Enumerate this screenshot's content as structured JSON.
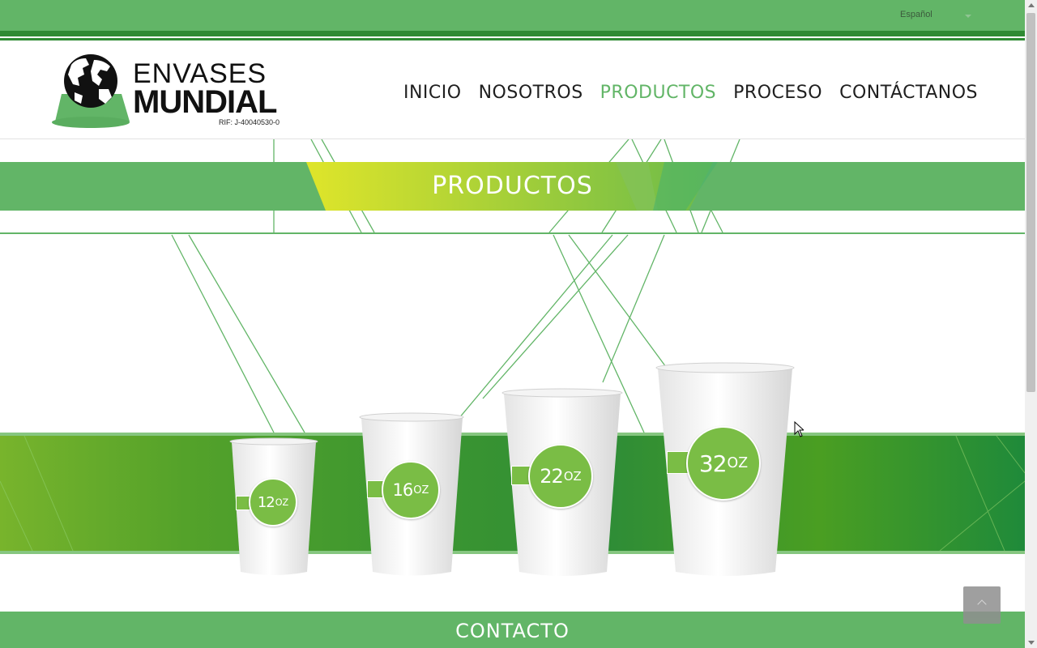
{
  "language_selector": {
    "value": "Español"
  },
  "logo": {
    "word1": "ENVASES",
    "word2": "MUNDIAL",
    "rif": "RIF: J-40040530-0"
  },
  "nav": {
    "items": [
      {
        "label": "INICIO",
        "active": false
      },
      {
        "label": "NOSOTROS",
        "active": false
      },
      {
        "label": "PRODUCTOS",
        "active": true
      },
      {
        "label": "PROCESO",
        "active": false
      },
      {
        "label": "CONTÁCTANOS",
        "active": false
      }
    ]
  },
  "page_title": "PRODUCTOS",
  "cups": [
    {
      "size": "12",
      "unit": "OZ"
    },
    {
      "size": "16",
      "unit": "OZ"
    },
    {
      "size": "22",
      "unit": "OZ"
    },
    {
      "size": "32",
      "unit": "OZ"
    }
  ],
  "contact_title": "CONTACTO",
  "colors": {
    "primary_green": "#62b567",
    "dark_green": "#2f8a33",
    "badge_green": "#7abd45"
  },
  "icons": {
    "back_to_top": "chevron-up-icon",
    "language_caret": "caret-down-icon"
  }
}
